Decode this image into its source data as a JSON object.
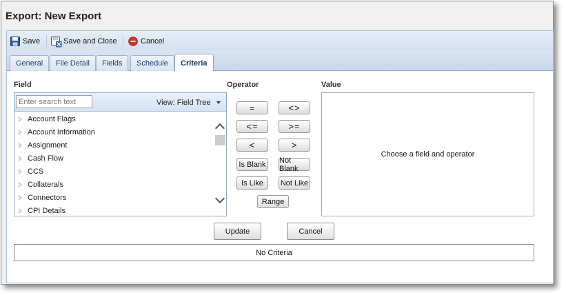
{
  "window": {
    "title": "Export: New Export"
  },
  "toolbar": {
    "save_label": "Save",
    "save_close_label": "Save and Close",
    "cancel_label": "Cancel"
  },
  "tabs": [
    {
      "label": "General",
      "active": false
    },
    {
      "label": "File Detail",
      "active": false
    },
    {
      "label": "Fields",
      "active": false
    },
    {
      "label": "Schedule",
      "active": false
    },
    {
      "label": "Criteria",
      "active": true
    }
  ],
  "field": {
    "label": "Field",
    "search_placeholder": "Enter search text",
    "view_label": "View: Field Tree",
    "items": [
      "Account Flags",
      "Account Information",
      "Assignment",
      "Cash Flow",
      "CCS",
      "Collaterals",
      "Connectors",
      "CPI Details"
    ]
  },
  "operator": {
    "label": "Operator",
    "buttons": [
      "=",
      "<>",
      "<=",
      ">=",
      "<",
      ">",
      "Is Blank",
      "Not Blank",
      "Is Like",
      "Not Like",
      "Range"
    ]
  },
  "value": {
    "label": "Value",
    "placeholder_text": "Choose a field and operator"
  },
  "actions": {
    "update_label": "Update",
    "cancel_label": "Cancel"
  },
  "criteria": {
    "status_text": "No Criteria"
  },
  "icons": {
    "save": "save-icon",
    "save_close": "save-close-icon",
    "cancel": "cancel-icon",
    "expand": "expand-triangle-icon",
    "dropdown": "chevron-down-icon",
    "scroll_up": "scroll-up-icon",
    "scroll_down": "scroll-down-icon"
  },
  "colors": {
    "toolbar_bg": "#d3e0f0",
    "tab_text": "#1d3f74",
    "cancel_red": "#d9342b",
    "save_blue": "#2a5da8"
  }
}
